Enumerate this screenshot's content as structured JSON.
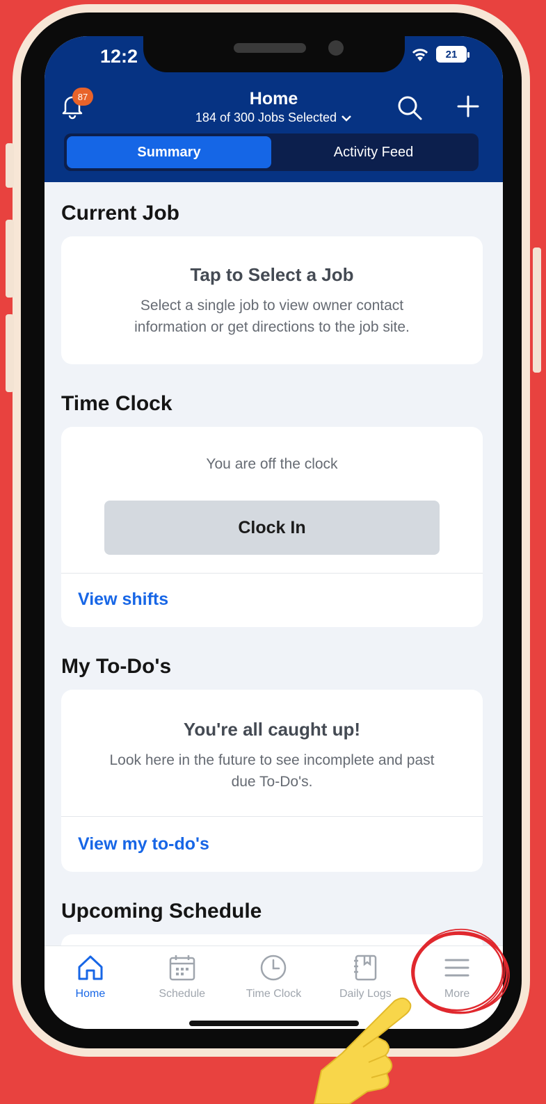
{
  "status_bar": {
    "time": "12:2",
    "battery": "21"
  },
  "header": {
    "notification_count": "87",
    "title": "Home",
    "subtitle": "184 of 300 Jobs Selected"
  },
  "tabs": [
    {
      "label": "Summary",
      "active": true
    },
    {
      "label": "Activity Feed",
      "active": false
    }
  ],
  "current_job": {
    "section_title": "Current Job",
    "card_title": "Tap to Select a Job",
    "card_text_line1": "Select a single job to view owner contact",
    "card_text_line2": "information or get directions to the job site."
  },
  "time_clock": {
    "section_title": "Time Clock",
    "status_text": "You are off the clock",
    "button_label": "Clock In",
    "link_label": "View shifts"
  },
  "todos": {
    "section_title": "My To-Do's",
    "card_title": "You're all caught up!",
    "card_text_line1": "Look here in the future to see incomplete and past",
    "card_text_line2": "due To-Do's.",
    "link_label": "View my to-do's"
  },
  "upcoming": {
    "section_title": "Upcoming Schedule"
  },
  "bottom_nav": [
    {
      "label": "Home",
      "icon": "home-icon",
      "active": true
    },
    {
      "label": "Schedule",
      "icon": "calendar-icon",
      "active": false
    },
    {
      "label": "Time Clock",
      "icon": "clock-icon",
      "active": false
    },
    {
      "label": "Daily Logs",
      "icon": "notebook-icon",
      "active": false
    },
    {
      "label": "More",
      "icon": "menu-icon",
      "active": false
    }
  ],
  "colors": {
    "background": "#E8423F",
    "header": "#063383",
    "accent": "#1766E6",
    "badge": "#E8632A",
    "annotation": "#E0282E",
    "pointer": "#F8D64A"
  }
}
